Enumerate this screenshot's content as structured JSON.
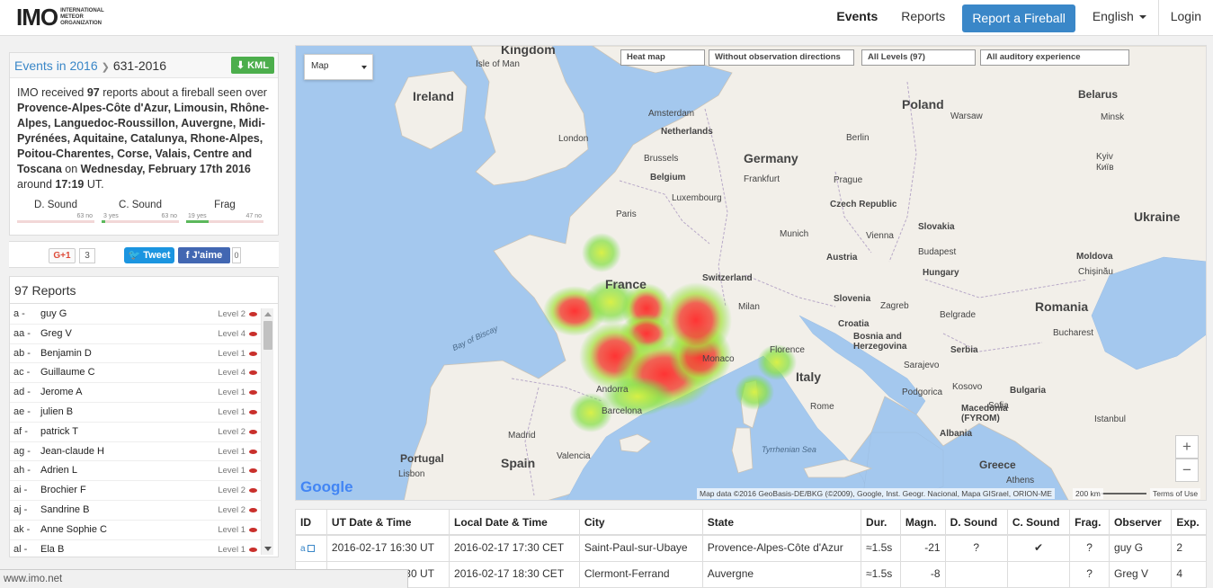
{
  "brand": {
    "logo": "IMO",
    "subtitle": "International Meteor Organization"
  },
  "nav": {
    "events": "Events",
    "reports": "Reports",
    "report_button": "Report a Fireball",
    "language": "English",
    "login": "Login"
  },
  "event": {
    "breadcrumb_parent": "Events in 2016",
    "breadcrumb_current": "631-2016",
    "kml_label": "KML",
    "desc_intro": "IMO received ",
    "report_count": "97",
    "desc_mid": " reports about a fireball seen over ",
    "regions": "Provence-Alpes-Côte d'Azur, Limousin, Rhône-Alpes, Languedoc-Roussillon, Auvergne, Midi-Pyrénées, Aquitaine, Catalunya, Rhone-Alpes, Poitou-Charentes, Corse, Valais, Centre and Toscana",
    "desc_on": " on ",
    "date": "Wednesday, February 17th 2016",
    "desc_around": " around ",
    "time": "17:19",
    "desc_ut": " UT."
  },
  "stats": {
    "dsound": {
      "label": "D. Sound",
      "yes": "",
      "no": "63 no",
      "yes_fraction": 0
    },
    "csound": {
      "label": "C. Sound",
      "yes": "3 yes",
      "no": "63 no",
      "yes_fraction": 0.045
    },
    "frag": {
      "label": "Frag",
      "yes": "19 yes",
      "no": "47 no",
      "yes_fraction": 0.29
    }
  },
  "share": {
    "gplus": "G+1",
    "gplus_count": "3",
    "tweet": "Tweet",
    "facebook": "J'aime",
    "fb_count": "0"
  },
  "reports": {
    "title": "97 Reports",
    "items": [
      {
        "id": "a -",
        "name": "guy G",
        "level": "Level 2"
      },
      {
        "id": "aa -",
        "name": "Greg V",
        "level": "Level 4"
      },
      {
        "id": "ab -",
        "name": "Benjamin D",
        "level": "Level 1"
      },
      {
        "id": "ac -",
        "name": "Guillaume C",
        "level": "Level 4"
      },
      {
        "id": "ad -",
        "name": "Jerome A",
        "level": "Level 1"
      },
      {
        "id": "ae -",
        "name": "julien B",
        "level": "Level 1"
      },
      {
        "id": "af -",
        "name": "patrick T",
        "level": "Level 2"
      },
      {
        "id": "ag -",
        "name": "Jean-claude H",
        "level": "Level 1"
      },
      {
        "id": "ah -",
        "name": "Adrien L",
        "level": "Level 1"
      },
      {
        "id": "ai -",
        "name": "Brochier F",
        "level": "Level 2"
      },
      {
        "id": "aj -",
        "name": "Sandrine B",
        "level": "Level 2"
      },
      {
        "id": "ak -",
        "name": "Anne Sophie C",
        "level": "Level 1"
      },
      {
        "id": "al -",
        "name": "Ela B",
        "level": "Level 1"
      }
    ]
  },
  "map": {
    "type_select": "Map",
    "filters": [
      "Heat map",
      "Without observation directions",
      "All Levels (97)",
      "All auditory experience"
    ],
    "zoom_in": "+",
    "zoom_out": "−",
    "google": "Google",
    "attribution": "Map data ©2016 GeoBasis-DE/BKG (©2009), Google, Inst. Geogr. Nacional, Mapa GISrael, ORION-ME",
    "scale": "200 km",
    "terms": "Terms of Use",
    "labels": {
      "kingdom": "Kingdom",
      "isle_of_man": "Isle of Man",
      "ireland": "Ireland",
      "poland": "Poland",
      "belarus": "Belarus",
      "warsaw": "Warsaw",
      "minsk": "Minsk",
      "amsterdam": "Amsterdam",
      "netherlands": "Netherlands",
      "london": "London",
      "berlin": "Berlin",
      "germany": "Germany",
      "brussels": "Brussels",
      "belgium": "Belgium",
      "luxembourg": "Luxembourg",
      "frankfurt": "Frankfurt",
      "prague": "Prague",
      "czech": "Czech Republic",
      "kyiv": "Kyiv",
      "kiev": "Київ",
      "ukraine": "Ukraine",
      "paris": "Paris",
      "munich": "Munich",
      "vienna": "Vienna",
      "slovakia": "Slovakia",
      "austria": "Austria",
      "budapest": "Budapest",
      "hungary": "Hungary",
      "moldova": "Moldova",
      "chisinau": "Chișinău",
      "france": "France",
      "switzerland": "Switzerland",
      "slovenia": "Slovenia",
      "zagreb": "Zagreb",
      "croatia": "Croatia",
      "milan": "Milan",
      "belgrade": "Belgrade",
      "romania": "Romania",
      "bay_of_biscay": "Bay of Biscay",
      "bosnia": "Bosnia and Herzegovina",
      "serbia": "Serbia",
      "bucharest": "Bucharest",
      "monaco": "Monaco",
      "florence": "Florence",
      "sarajevo": "Sarajevo",
      "italy": "Italy",
      "kosovo": "Kosovo",
      "bulgaria": "Bulgaria",
      "andorra": "Andorra",
      "podgorica": "Podgorica",
      "sofia": "Sofia",
      "barcelona": "Barcelona",
      "rome": "Rome",
      "macedonia": "Macedonia (FYROM)",
      "istanbul": "Istanbul",
      "madrid": "Madrid",
      "portugal": "Portugal",
      "tyrrhenian": "Tyrrhenian Sea",
      "albania": "Albania",
      "spain": "Spain",
      "valencia": "Valencia",
      "lisbon": "Lisbon",
      "greece": "Greece",
      "athens": "Athens"
    }
  },
  "table": {
    "headers": [
      "ID",
      "UT Date & Time",
      "Local Date & Time",
      "City",
      "State",
      "Dur.",
      "Magn.",
      "D. Sound",
      "C. Sound",
      "Frag.",
      "Observer",
      "Exp."
    ],
    "rows": [
      {
        "id": "a",
        "ut": "2016-02-17 16:30 UT",
        "local": "2016-02-17 17:30 CET",
        "city": "Saint-Paul-sur-Ubaye",
        "state": "Provence-Alpes-Côte d'Azur",
        "dur": "≈1.5s",
        "magn": "-21",
        "dsound": "?",
        "csound": "✔",
        "frag": "?",
        "observer": "guy G",
        "exp": "2"
      },
      {
        "id": "aa",
        "ut": "2016-02-17 16:30 UT",
        "local": "2016-02-17 18:30 CET",
        "city": "Clermont-Ferrand",
        "state": "Auvergne",
        "dur": "≈1.5s",
        "magn": "-8",
        "dsound": "",
        "csound": "",
        "frag": "?",
        "observer": "Greg V",
        "exp": "4"
      }
    ]
  },
  "status_bar": {
    "url": "www.imo.net"
  },
  "colors": {
    "accent": "#3a87c8",
    "kml_green": "#4cae4c",
    "level_dot": "#c9302c",
    "water": "#a4c8ee",
    "land": "#f2efe9"
  }
}
